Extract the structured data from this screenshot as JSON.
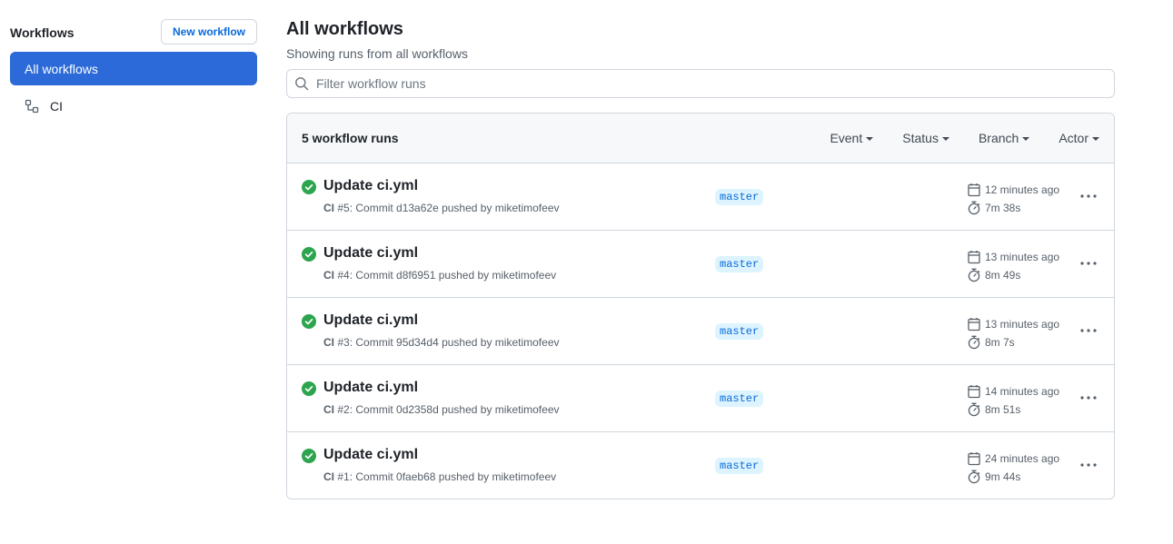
{
  "sidebar": {
    "title": "Workflows",
    "new_button": "New workflow",
    "items": [
      {
        "label": "All workflows"
      },
      {
        "label": "CI"
      }
    ]
  },
  "main": {
    "title": "All workflows",
    "subtitle": "Showing runs from all workflows",
    "filter_placeholder": "Filter workflow runs"
  },
  "runs_header": {
    "count_label": "5 workflow runs",
    "filters": [
      "Event",
      "Status",
      "Branch",
      "Actor"
    ]
  },
  "runs": [
    {
      "title": "Update ci.yml",
      "workflow": "CI",
      "number": "#5",
      "meta": ": Commit d13a62e pushed by miketimofeev",
      "branch": "master",
      "when": "12 minutes ago",
      "duration": "7m 38s"
    },
    {
      "title": "Update ci.yml",
      "workflow": "CI",
      "number": "#4",
      "meta": ": Commit d8f6951 pushed by miketimofeev",
      "branch": "master",
      "when": "13 minutes ago",
      "duration": "8m 49s"
    },
    {
      "title": "Update ci.yml",
      "workflow": "CI",
      "number": "#3",
      "meta": ": Commit 95d34d4 pushed by miketimofeev",
      "branch": "master",
      "when": "13 minutes ago",
      "duration": "8m 7s"
    },
    {
      "title": "Update ci.yml",
      "workflow": "CI",
      "number": "#2",
      "meta": ": Commit 0d2358d pushed by miketimofeev",
      "branch": "master",
      "when": "14 minutes ago",
      "duration": "8m 51s"
    },
    {
      "title": "Update ci.yml",
      "workflow": "CI",
      "number": "#1",
      "meta": ": Commit 0faeb68 pushed by miketimofeev",
      "branch": "master",
      "when": "24 minutes ago",
      "duration": "9m 44s"
    }
  ],
  "colors": {
    "accent": "#2b6ad8",
    "link": "#0969da",
    "success": "#2da44e",
    "border": "#d0d7de"
  }
}
